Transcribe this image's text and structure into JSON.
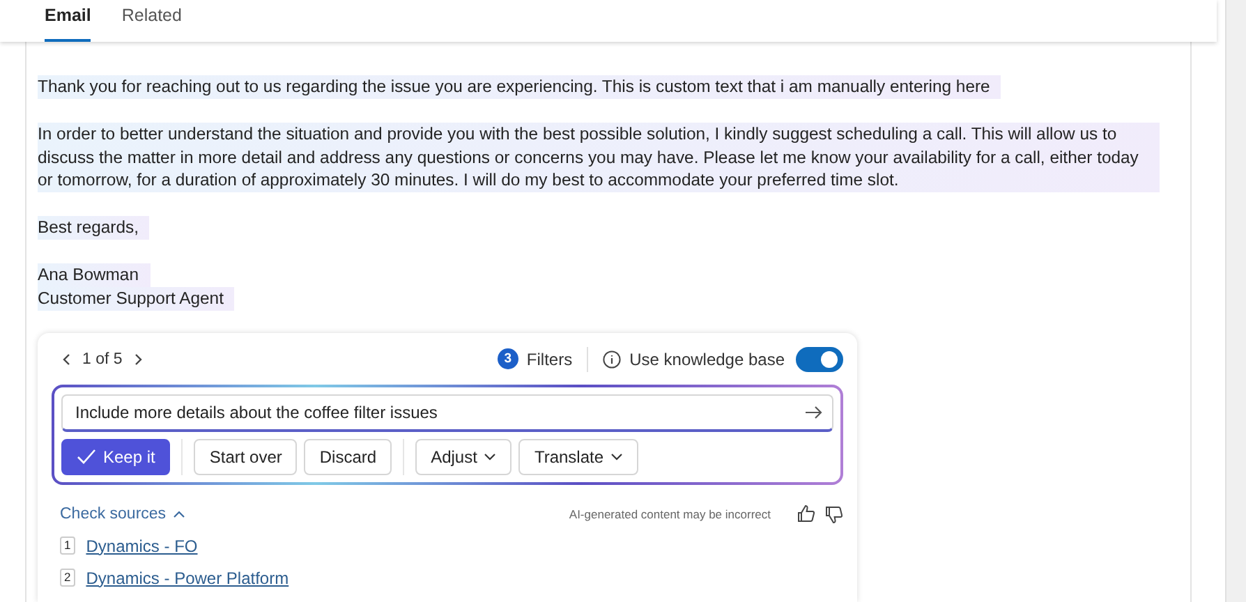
{
  "tabs": [
    {
      "label": "Email",
      "selected": true
    },
    {
      "label": "Related",
      "selected": false
    }
  ],
  "email": {
    "paragraphs": [
      {
        "text": "Thank you for reaching out to us regarding the issue you are experiencing. This is custom text that i am manually entering here"
      },
      {
        "text": "In order to better understand the situation and provide you with the best possible solution, I kindly suggest scheduling a call. This will allow us to discuss the matter in more detail and address any questions or concerns you may have. Please let me know your availability for a call, either today or tomorrow, for a duration of approximately 30 minutes. I will do my best to accommodate your preferred time slot."
      },
      {
        "text": "Best regards,"
      }
    ],
    "signature": [
      "Ana Bowman",
      "Customer Support Agent"
    ]
  },
  "copilot": {
    "pager": "1 of 5",
    "filters_count": "3",
    "filters_label": "Filters",
    "knowledge_label": "Use knowledge base",
    "knowledge_on": true,
    "prompt": "Include more details about the coffee filter issues",
    "buttons": [
      {
        "label": "Keep it",
        "kind": "primary"
      },
      {
        "kind": "divider"
      },
      {
        "label": "Start over",
        "kind": "plain"
      },
      {
        "label": "Discard",
        "kind": "plain"
      },
      {
        "kind": "divider"
      },
      {
        "label": "Adjust",
        "kind": "menu"
      },
      {
        "label": "Translate",
        "kind": "menu"
      }
    ],
    "check_sources": "Check sources",
    "disclaimer": "AI-generated content may be incorrect",
    "sources": [
      {
        "number": "1",
        "title": "Dynamics - FO"
      },
      {
        "number": "2",
        "title": "Dynamics - Power Platform"
      }
    ]
  }
}
